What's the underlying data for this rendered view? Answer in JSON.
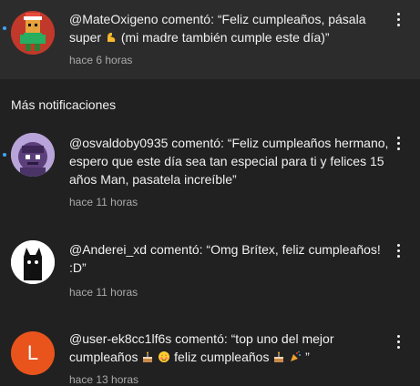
{
  "section_title": "Más notificaciones",
  "notifications": [
    {
      "author": "@MateOxigeno",
      "verb": "comentó:",
      "comment_a": "“Feliz cumpleaños, pásala super",
      "comment_b": "(mi madre también cumple este día)”",
      "time": "hace 6 horas",
      "unread": true,
      "emoji": "strong-arm-icon"
    },
    {
      "author": "@osvaldoby0935",
      "verb": "comentó:",
      "comment": "“Feliz cumpleaños hermano, espero que este día sea tan especial para ti y felices 15 años Man, pasatela increíble”",
      "time": "hace 11 horas",
      "unread": true
    },
    {
      "author": "@Anderei_xd",
      "verb": "comentó:",
      "comment": "“Omg Brítex, feliz cumpleaños! :D”",
      "time": "hace 11 horas",
      "unread": false
    },
    {
      "author": "@user-ek8cc1lf6s",
      "verb": "comentó:",
      "comment_a": "“top uno del mejor cumpleaños",
      "comment_b": "feliz cumpleaños",
      "comment_c": "”",
      "avatar_letter": "L",
      "time": "hace 13 horas",
      "unread": false
    }
  ],
  "colors": {
    "background": "#212121",
    "highlight": "#2c2c2c",
    "unread_dot": "#3ea6ff",
    "secondary_text": "#aaaaaa",
    "avatar_orange": "#e8541c"
  }
}
